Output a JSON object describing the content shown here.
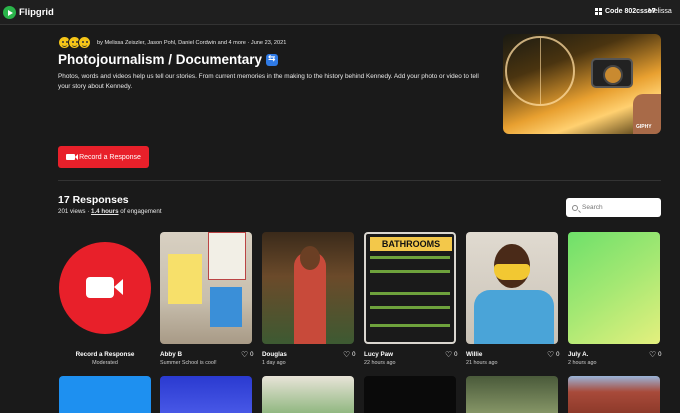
{
  "app": {
    "name": "Flipgrid"
  },
  "header": {
    "code_label": "Code 802csse7",
    "user_name": "Melissa"
  },
  "topic": {
    "authors": "by Melissa Zeiszler, Jason Pohl, Daniel Cordwin and 4 more · June 23, 2021",
    "title": "Photojournalism / Documentary",
    "description": "Photos, words and videos help us tell our stories. From current memories in the making to the history behind Kennedy. Add your photo or video to tell your story about Kennedy.",
    "media_badge": "GIPHY",
    "record_button_label": "Record a Response"
  },
  "responses": {
    "title": "17 Responses",
    "views": "201 views · ",
    "engagement_hours": "1.4 hours",
    "engagement_suffix": " of engagement",
    "search_placeholder": "Search",
    "record_card": {
      "label": "Record a Response",
      "sublabel": "Moderated"
    },
    "cards": [
      {
        "name": "Abby B",
        "time": "Summer School is cool!",
        "likes": "0"
      },
      {
        "name": "Douglas",
        "time": "1 day ago",
        "likes": "0"
      },
      {
        "name": "Lucy Paw",
        "time": "22 hours ago",
        "likes": "0"
      },
      {
        "name": "Willie",
        "time": "21 hours ago",
        "likes": "0"
      },
      {
        "name": "July A.",
        "time": "2 hours ago",
        "likes": "0"
      }
    ]
  },
  "thumbnail_text": {
    "bathrooms_sign": "BATHROOMS"
  },
  "colors": {
    "accent_red": "#e8202a",
    "background": "#1a1a1a",
    "brand_green": "#2ab44a"
  }
}
